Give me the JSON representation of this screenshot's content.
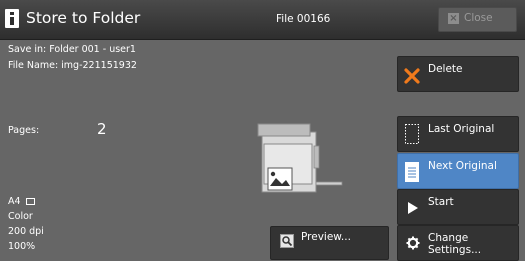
{
  "header": {
    "title": "Store to Folder",
    "file": "File 00166",
    "close_label": "Close"
  },
  "info": {
    "save_in": "Save in: Folder 001 - user1",
    "file_name": "File Name: img-221151932",
    "pages_label": "Pages:",
    "pages_value": "2",
    "paper_size": "A4",
    "color_mode": "Color",
    "resolution": "200 dpi",
    "zoom": "100%"
  },
  "buttons": {
    "delete": "Delete",
    "last_original": "Last Original",
    "next_original": "Next Original",
    "start": "Start",
    "change_settings_line1": "Change",
    "change_settings_line2": "Settings...",
    "preview": "Preview..."
  },
  "colors": {
    "background": "#666666",
    "selected_accent": "#4f86c6",
    "delete_icon": "#f07a1c"
  }
}
